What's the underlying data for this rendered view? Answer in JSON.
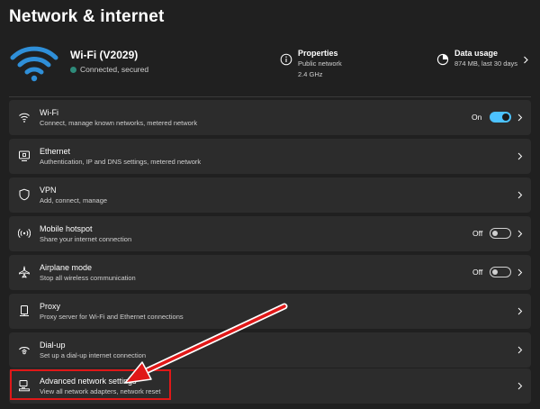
{
  "page": {
    "title": "Network & internet"
  },
  "summary": {
    "network_name": "Wi-Fi (V2029)",
    "network_status": "Connected, secured",
    "properties": {
      "title": "Properties",
      "line1": "Public network",
      "line2": "2.4 GHz"
    },
    "data_usage": {
      "title": "Data usage",
      "detail": "874 MB, last 30 days"
    }
  },
  "rows": [
    {
      "id": "wifi",
      "icon": "wifi-icon",
      "title": "Wi-Fi",
      "desc": "Connect, manage known networks, metered network",
      "toggle": true,
      "toggle_label": "On"
    },
    {
      "id": "ethernet",
      "icon": "ethernet-icon",
      "title": "Ethernet",
      "desc": "Authentication, IP and DNS settings, metered network"
    },
    {
      "id": "vpn",
      "icon": "shield-icon",
      "title": "VPN",
      "desc": "Add, connect, manage"
    },
    {
      "id": "hotspot",
      "icon": "hotspot-icon",
      "title": "Mobile hotspot",
      "desc": "Share your internet connection",
      "toggle": false,
      "toggle_label": "Off"
    },
    {
      "id": "airplane",
      "icon": "airplane-icon",
      "title": "Airplane mode",
      "desc": "Stop all wireless communication",
      "toggle": false,
      "toggle_label": "Off"
    },
    {
      "id": "proxy",
      "icon": "proxy-icon",
      "title": "Proxy",
      "desc": "Proxy server for Wi-Fi and Ethernet connections"
    },
    {
      "id": "dialup",
      "icon": "dialup-icon",
      "title": "Dial-up",
      "desc": "Set up a dial-up internet connection"
    },
    {
      "id": "advanced",
      "icon": "advanced-network-icon",
      "title": "Advanced network settings",
      "desc": "View all network adapters, network reset"
    }
  ],
  "colors": {
    "accent": "#4cc2ff",
    "annotation": "#e01818",
    "background": "#202020",
    "card": "#2c2c2c"
  }
}
